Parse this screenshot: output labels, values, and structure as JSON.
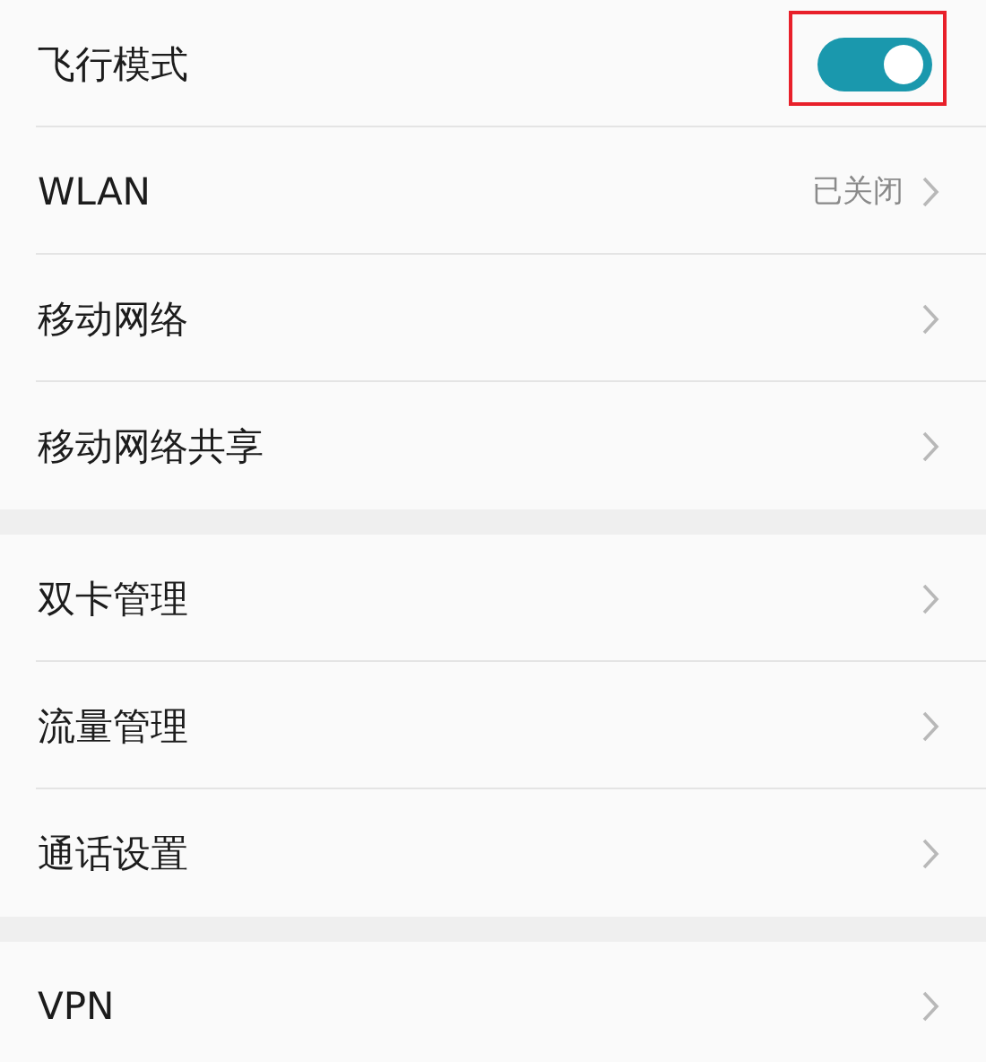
{
  "sections": [
    {
      "rows": [
        {
          "kind": "toggle",
          "label": "飞行模式",
          "on": true,
          "highlighted": true
        },
        {
          "kind": "link",
          "label": "WLAN",
          "value": "已关闭"
        },
        {
          "kind": "link",
          "label": "移动网络"
        },
        {
          "kind": "link",
          "label": "移动网络共享"
        }
      ]
    },
    {
      "rows": [
        {
          "kind": "link",
          "label": "双卡管理"
        },
        {
          "kind": "link",
          "label": "流量管理"
        },
        {
          "kind": "link",
          "label": "通话设置"
        }
      ]
    },
    {
      "rows": [
        {
          "kind": "link",
          "label": "VPN"
        }
      ]
    }
  ]
}
